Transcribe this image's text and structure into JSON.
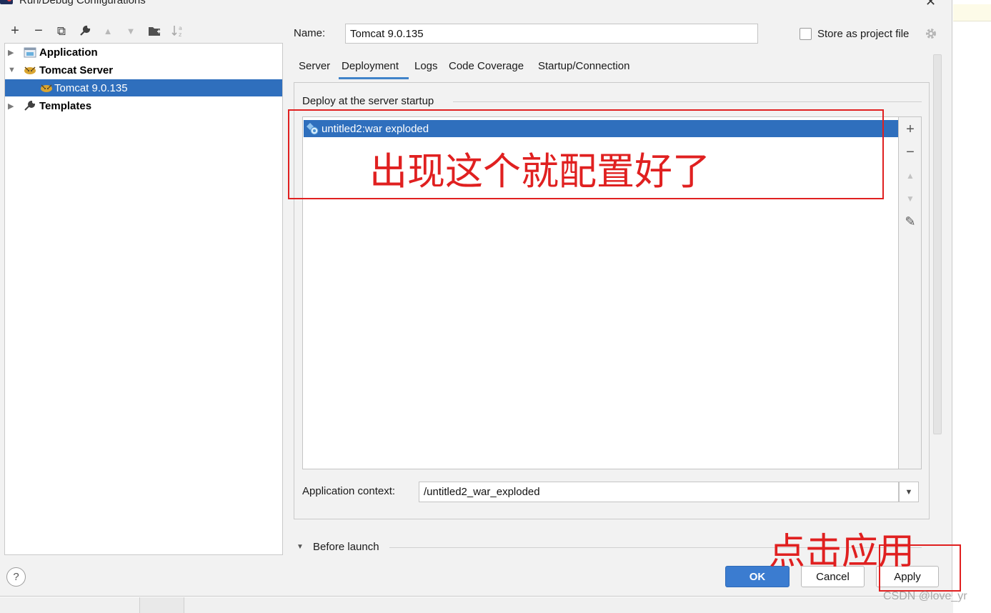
{
  "window": {
    "title": "Run/Debug Configurations"
  },
  "toolbar": {
    "add": "+",
    "remove": "−",
    "copy": "⧉",
    "edit_templates": "🔧",
    "move_up": "▲",
    "move_down": "▼",
    "new_folder": "▆",
    "sort": "↓a z"
  },
  "tree": {
    "items": [
      {
        "label": "Application",
        "arrow": "▶"
      },
      {
        "label": "Tomcat Server",
        "arrow": "▼"
      },
      {
        "label": "Tomcat 9.0.135"
      },
      {
        "label": "Templates",
        "arrow": "▶"
      }
    ]
  },
  "form": {
    "name_label": "Name:",
    "name_value": "Tomcat 9.0.135",
    "store_label": "Store as project file",
    "store_checked": false
  },
  "tabs": [
    "Server",
    "Deployment",
    "Logs",
    "Code Coverage",
    "Startup/Connection"
  ],
  "active_tab": "Deployment",
  "deployment": {
    "section_title": "Deploy at the server startup",
    "artifacts": [
      "untitled2:war exploded"
    ],
    "side_buttons": {
      "add": "+",
      "remove": "−",
      "up": "▲",
      "down": "▼",
      "edit": "✎"
    },
    "context_label": "Application context:",
    "context_value": "/untitled2_war_exploded"
  },
  "before_launch": {
    "label": "Before launch",
    "arrow": "▼"
  },
  "buttons": {
    "help": "?",
    "ok": "OK",
    "cancel": "Cancel",
    "apply": "Apply"
  },
  "annotations": {
    "configured": "出现这个就配置好了",
    "click_apply": "点击应用",
    "color": "#e02020"
  },
  "watermark": "CSDN @love_yr"
}
